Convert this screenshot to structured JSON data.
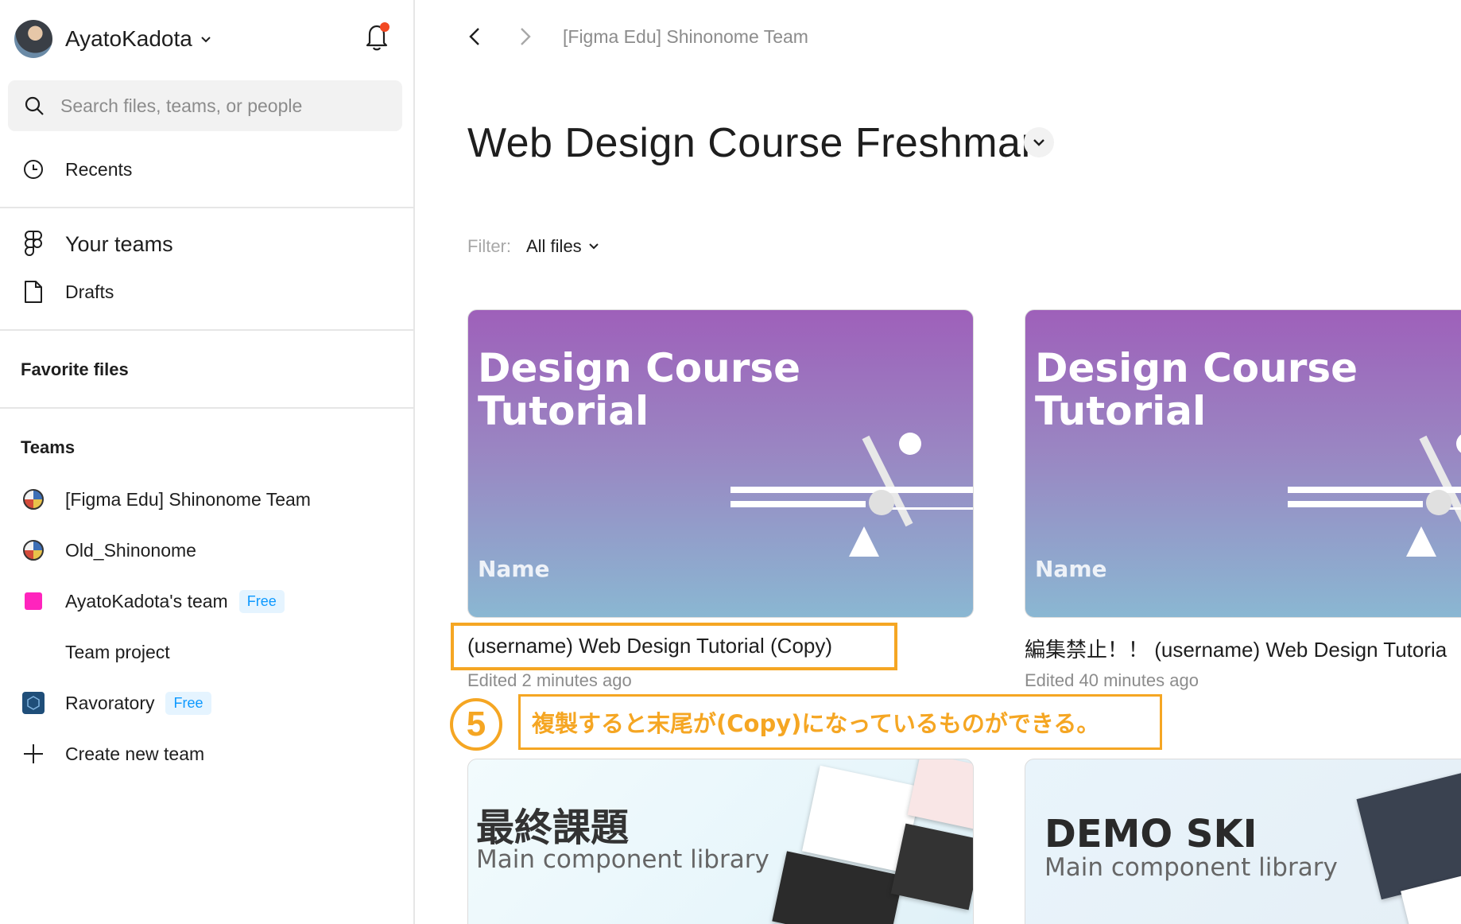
{
  "sidebar": {
    "user": {
      "name": "AyatoKadota"
    },
    "search": {
      "placeholder": "Search files, teams, or people"
    },
    "recents_label": "Recents",
    "your_teams_label": "Your teams",
    "drafts_label": "Drafts",
    "favorite_files_label": "Favorite files",
    "teams_label": "Teams",
    "teams": [
      {
        "name": "[Figma Edu] Shinonome Team",
        "badge": ""
      },
      {
        "name": "Old_Shinonome",
        "badge": ""
      },
      {
        "name": "AyatoKadota's team",
        "badge": "Free"
      },
      {
        "name": "Team project",
        "badge": ""
      },
      {
        "name": "Ravoratory",
        "badge": "Free"
      }
    ],
    "create_team_label": "Create new team"
  },
  "main": {
    "breadcrumb": "[Figma Edu] Shinonome Team",
    "title": "Web Design Course Freshman",
    "filter_label": "Filter:",
    "filter_value": "All files",
    "files": [
      {
        "thumb_title_line1": "Design Course",
        "thumb_title_line2": "Tutorial",
        "thumb_name": "Name",
        "name": "(username) Web Design Tutorial (Copy)",
        "edited": "Edited 2 minutes ago"
      },
      {
        "thumb_title_line1": "Design Course",
        "thumb_title_line2": "Tutorial",
        "thumb_name": "Name",
        "name": "編集禁止！！ (username) Web Design Tutoria",
        "edited": "Edited 40 minutes ago"
      },
      {
        "thumb_title": "最終課題",
        "thumb_sub": "Main component library"
      },
      {
        "thumb_title": "DEMO SKI",
        "thumb_sub": "Main component library"
      }
    ]
  },
  "annotation": {
    "step": "5",
    "text": "複製すると末尾が(Copy)になっているものができる。",
    "color": "#f5a623"
  },
  "colors": {
    "accent_blue": "#0d99ff",
    "notification": "#f24822",
    "team_pink": "#ff24bd"
  }
}
